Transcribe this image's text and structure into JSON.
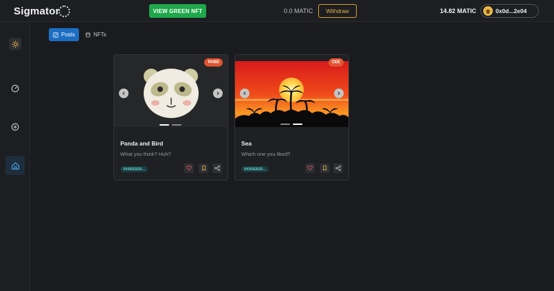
{
  "header": {
    "logo": "Sigmator",
    "view_nft_label": "VIEW GREEN NFT",
    "matic_balance": "0.0 MATIC",
    "withdraw_label": "Withdraw",
    "wallet_balance": "14.82 MATIC",
    "wallet_address": "0x0d...2e04"
  },
  "sidebar": {
    "items": [
      "sun-icon",
      "gauge-icon",
      "plus-icon",
      "home-icon"
    ]
  },
  "tabs": [
    {
      "label": "Posts",
      "active": true
    },
    {
      "label": "NFTs",
      "active": false
    }
  ],
  "posts": [
    {
      "badge": "PABD",
      "title": "Panda and Bird",
      "description": "What you think? Huh?",
      "address": "0X0DE82D..."
    },
    {
      "badge": "CEE",
      "title": "Sea",
      "description": "Which one you liked?",
      "address": "0X0DE82D..."
    }
  ],
  "colors": {
    "background": "#1a1b1e",
    "accent_blue": "#1b6ec2",
    "green_button": "#1fa84a",
    "withdraw_border": "#d9a33a",
    "badge": "#e0552f"
  }
}
